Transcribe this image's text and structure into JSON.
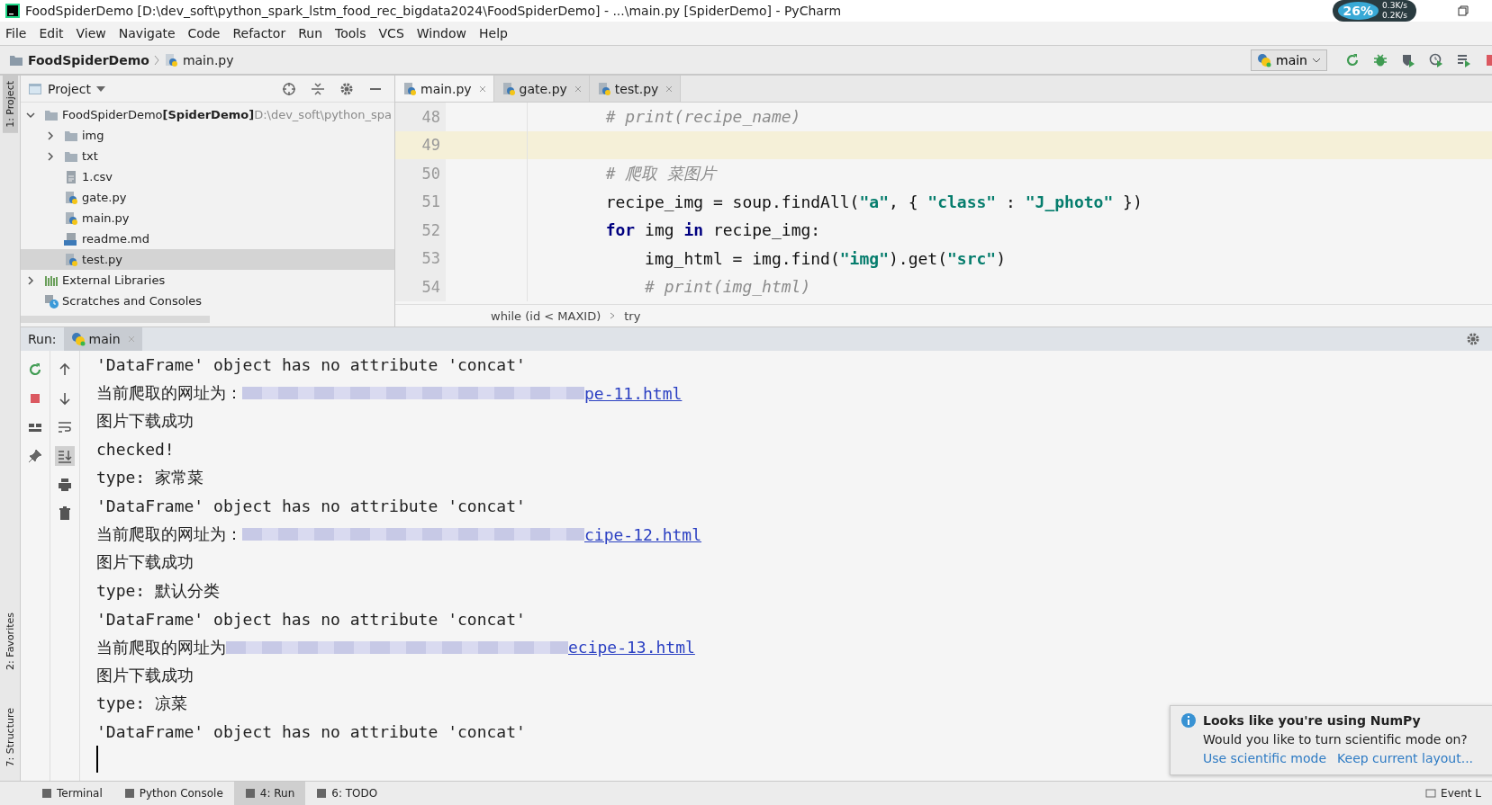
{
  "window": {
    "title": "FoodSpiderDemo [D:\\dev_soft\\python_spark_lstm_food_rec_bigdata2024\\FoodSpiderDemo] - ...\\main.py [SpiderDemo] - PyCharm"
  },
  "net_widget": {
    "percent": "26%",
    "up": "0.3K/s",
    "down": "0.2K/s"
  },
  "menu": [
    "File",
    "Edit",
    "View",
    "Navigate",
    "Code",
    "Refactor",
    "Run",
    "Tools",
    "VCS",
    "Window",
    "Help"
  ],
  "breadcrumb": {
    "project": "FoodSpiderDemo",
    "file": "main.py"
  },
  "run_config": "main",
  "side_tabs": {
    "top": "1: Project",
    "middle": "2: Favorites",
    "bottom": "7: Structure"
  },
  "project_panel": {
    "title": "Project",
    "tree": [
      {
        "label": "FoodSpiderDemo",
        "tag": "[SpiderDemo]",
        "path": "D:\\dev_soft\\python_spa",
        "kind": "root",
        "expanded": true,
        "selected": false,
        "children": [
          {
            "label": "img",
            "kind": "folder",
            "expanded": false,
            "selected": false
          },
          {
            "label": "txt",
            "kind": "folder",
            "expanded": false,
            "selected": false
          },
          {
            "label": "1.csv",
            "kind": "text",
            "selected": false
          },
          {
            "label": "gate.py",
            "kind": "python",
            "selected": false
          },
          {
            "label": "main.py",
            "kind": "python",
            "selected": false
          },
          {
            "label": "readme.md",
            "kind": "markdown",
            "selected": false
          },
          {
            "label": "test.py",
            "kind": "python",
            "selected": true
          }
        ]
      },
      {
        "label": "External Libraries",
        "kind": "library",
        "expanded": false,
        "selected": false
      },
      {
        "label": "Scratches and Consoles",
        "kind": "scratch",
        "selected": false
      }
    ]
  },
  "editor_tabs": [
    {
      "label": "main.py",
      "selected": true
    },
    {
      "label": "gate.py",
      "selected": false
    },
    {
      "label": "test.py",
      "selected": false
    }
  ],
  "code_lines": [
    {
      "number": "48",
      "highlighted": false,
      "tokens": [
        {
          "text": "        # print(recipe_name)",
          "kind": "comment"
        }
      ]
    },
    {
      "number": "49",
      "highlighted": true
    },
    {
      "number": "50",
      "highlighted": false,
      "tokens": [
        {
          "text": "        # 爬取 菜图片",
          "kind": "comment"
        }
      ]
    },
    {
      "number": "51",
      "highlighted": false,
      "tokens": [
        {
          "text": "        recipe_img = soup.findAll(",
          "kind": "plain"
        },
        {
          "text": "\"a\"",
          "kind": "string"
        },
        {
          "text": ", { ",
          "kind": "plain"
        },
        {
          "text": "\"class\"",
          "kind": "string"
        },
        {
          "text": " : ",
          "kind": "plain"
        },
        {
          "text": "\"J_photo\"",
          "kind": "string"
        },
        {
          "text": " })",
          "kind": "plain"
        }
      ]
    },
    {
      "number": "52",
      "highlighted": false,
      "tokens": [
        {
          "text": "        for",
          "kind": "keyword"
        },
        {
          "text": " img ",
          "kind": "plain"
        },
        {
          "text": "in",
          "kind": "keyword"
        },
        {
          "text": " recipe_img:",
          "kind": "plain"
        }
      ]
    },
    {
      "number": "53",
      "highlighted": false,
      "tokens": [
        {
          "text": "            img_html = img.find(",
          "kind": "plain"
        },
        {
          "text": "\"img\"",
          "kind": "string"
        },
        {
          "text": ").get(",
          "kind": "plain"
        },
        {
          "text": "\"src\"",
          "kind": "string"
        },
        {
          "text": ")",
          "kind": "plain"
        }
      ]
    },
    {
      "number": "54",
      "highlighted": false,
      "tokens": [
        {
          "text": "            # print(img_html)",
          "kind": "comment"
        }
      ]
    }
  ],
  "editor_breadcrumb": [
    "while (id < MAXID)",
    "try"
  ],
  "run_panel": {
    "label": "Run:",
    "tab": "main",
    "lines": [
      {
        "kind": "text",
        "text": "'DataFrame' object has no attribute 'concat'"
      },
      {
        "kind": "url",
        "text": "当前爬取的网址为：",
        "link": "pe-11.html"
      },
      {
        "kind": "text",
        "text": "图片下载成功"
      },
      {
        "kind": "text",
        "text": "checked!"
      },
      {
        "kind": "text",
        "text": "type: 家常菜"
      },
      {
        "kind": "text",
        "text": "'DataFrame' object has no attribute 'concat'"
      },
      {
        "kind": "url",
        "text": "当前爬取的网址为：",
        "link": "cipe-12.html"
      },
      {
        "kind": "text",
        "text": "图片下载成功"
      },
      {
        "kind": "text",
        "text": "type: 默认分类"
      },
      {
        "kind": "text",
        "text": "'DataFrame' object has no attribute 'concat'"
      },
      {
        "kind": "url",
        "text": "当前爬取的网址为",
        "link": "ecipe-13.html"
      },
      {
        "kind": "text",
        "text": "图片下载成功"
      },
      {
        "kind": "text",
        "text": "type: 凉菜"
      },
      {
        "kind": "text",
        "text": "'DataFrame' object has no attribute 'concat'"
      }
    ]
  },
  "notification": {
    "title": "Looks like you're using NumPy",
    "body": "Would you like to turn scientific mode on?",
    "actions": [
      "Use scientific mode",
      "Keep current layout..."
    ]
  },
  "bottom_tabs": [
    {
      "label": "Terminal",
      "selected": false
    },
    {
      "label": "Python Console",
      "selected": false
    },
    {
      "label": "4: Run",
      "selected": true
    },
    {
      "label": "6: TODO",
      "selected": false
    }
  ],
  "event_log": "Event L"
}
